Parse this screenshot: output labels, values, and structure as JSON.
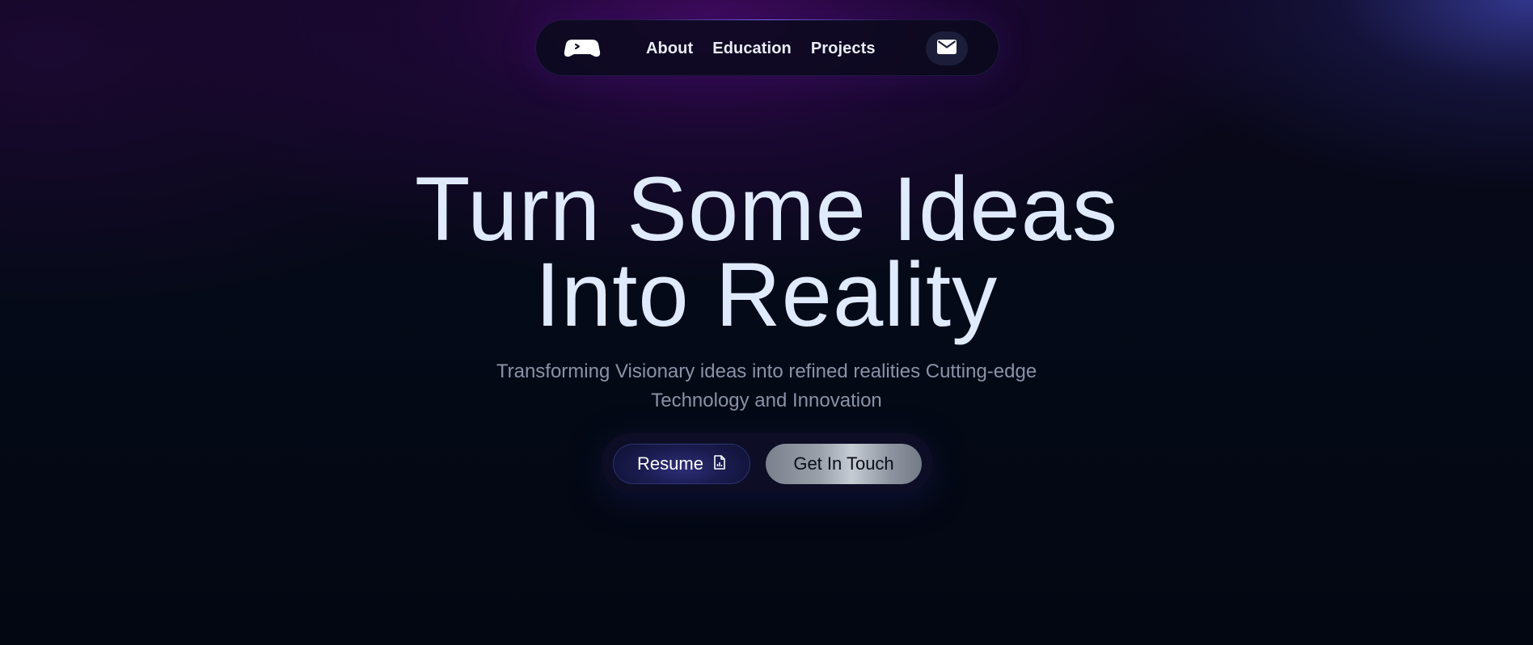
{
  "nav": {
    "logo_icon": "gamepad-logo-icon",
    "links": [
      {
        "label": "About"
      },
      {
        "label": "Education"
      },
      {
        "label": "Projects"
      }
    ],
    "contact_icon": "mail-icon"
  },
  "hero": {
    "title_line1": "Turn Some Ideas",
    "title_line2": "Into Reality",
    "subtitle": "Transforming Visionary ideas into refined realities Cutting-edge Technology and Innovation"
  },
  "cta": {
    "resume_label": "Resume",
    "resume_icon": "document-chart-icon",
    "touch_label": "Get In Touch"
  },
  "colors": {
    "title": "#dfeafc",
    "subtitle": "#8a92a6",
    "accent": "#2e2f7a",
    "background": "#030712"
  }
}
